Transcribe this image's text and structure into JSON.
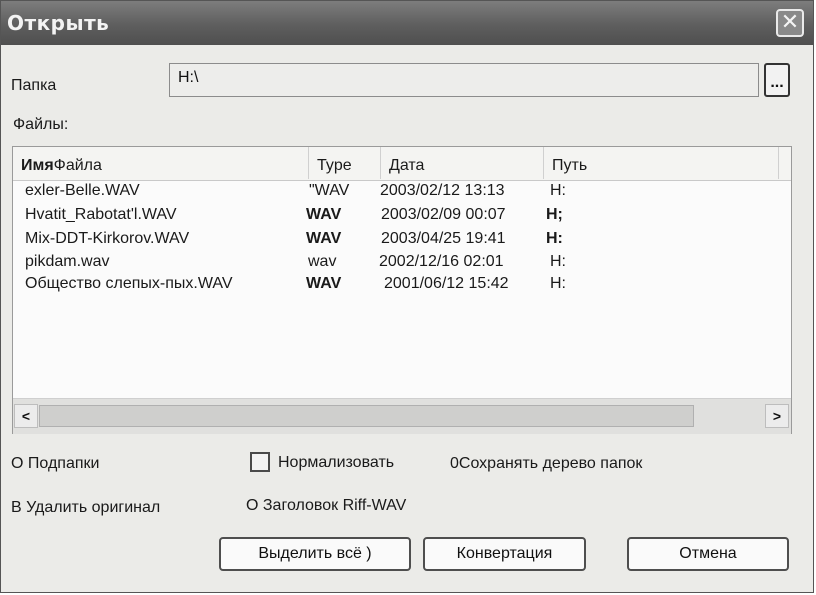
{
  "window": {
    "title": "Открыть",
    "close_glyph": "✕",
    "accent": "#5e5e5e"
  },
  "folder": {
    "label": "Папка",
    "value": "H:\\",
    "browse_glyph": "..."
  },
  "files": {
    "label": "Файлы:",
    "columns": {
      "name_bold": "Имя",
      "name_rest": "Файла",
      "type": "Type",
      "date": "Дата",
      "path": "Путь"
    },
    "rows": [
      {
        "name": "exler-Belle.WAV",
        "type": "\"WAV",
        "date": "2003/02/12 13:13",
        "path": "H:"
      },
      {
        "name": "Hvatit_Rabotat'l.WAV",
        "type": "WAV",
        "date": "2003/02/09 00:07",
        "path": "H;"
      },
      {
        "name": "Mix-DDT-Kirkorov.WAV",
        "type": "WAV",
        "date": "2003/04/25 19:41",
        "path": "H:"
      },
      {
        "name": "pikdam.wav",
        "type": "wav",
        "date": "2002/12/16 02:01",
        "path": "H:"
      },
      {
        "name": "Общество слепых-пых.WAV",
        "type": "WAV",
        "date": "2001/06/12 15:42",
        "path": "H:"
      }
    ],
    "scroll_left": "<",
    "scroll_right": ">"
  },
  "options": {
    "subfolders": "О Подпапки",
    "normalize": "Нормализовать",
    "keep_tree": "0Сохранять дерево папок",
    "delete_original": "В Удалить оригинал",
    "riff_header": "О Заголовок Riff-WAV"
  },
  "buttons": {
    "select_all": "Выделить всё )",
    "convert": "Конвертация",
    "cancel": "Отмена"
  }
}
